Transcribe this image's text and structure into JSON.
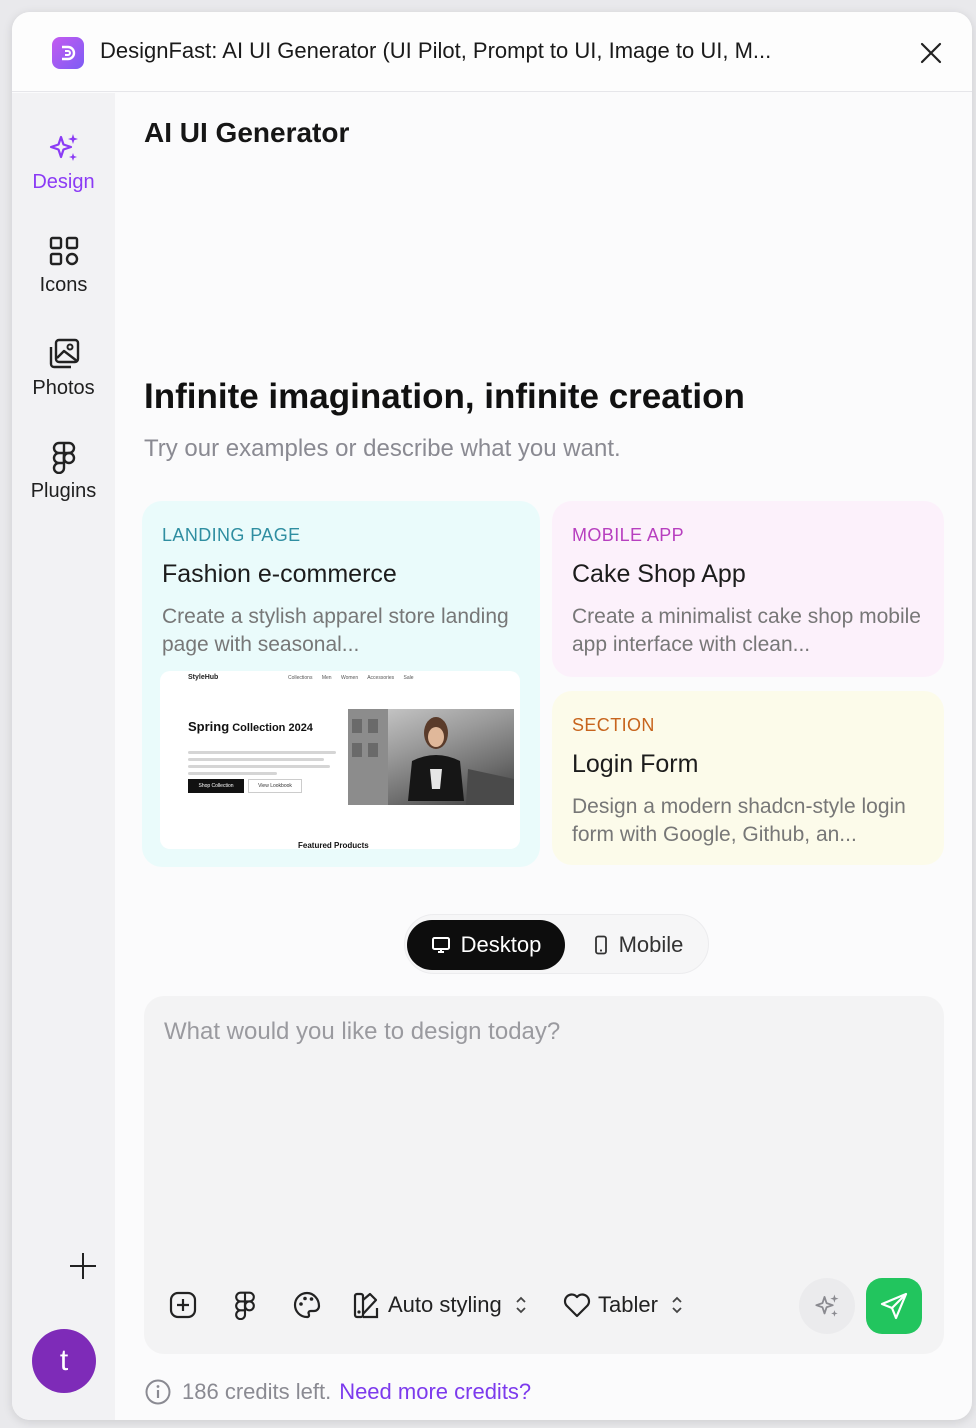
{
  "window": {
    "title": "DesignFast: AI UI Generator (UI Pilot, Prompt to UI, Image to UI, M..."
  },
  "sidebar": {
    "items": [
      {
        "label": "Design",
        "icon": "sparkles-icon"
      },
      {
        "label": "Icons",
        "icon": "grid-icon"
      },
      {
        "label": "Photos",
        "icon": "images-icon"
      },
      {
        "label": "Plugins",
        "icon": "figma-icon"
      }
    ],
    "avatar_letter": "t"
  },
  "main": {
    "page_title": "AI UI Generator",
    "hero_title": "Infinite imagination, infinite creation",
    "hero_subtitle": "Try our examples or describe what you want."
  },
  "cards": [
    {
      "tag": "LANDING PAGE",
      "tag_color": "#2f8ea1",
      "title": "Fashion e-commerce",
      "description": "Create a stylish apparel store landing page with seasonal...",
      "preview": {
        "brand": "StyleHub",
        "links": "Collections Men Women Accessories Sale",
        "heading_bold": "Spring",
        "heading_rest": " Collection 2024",
        "primary_button": "Shop Collection",
        "secondary_button": "View Lookbook",
        "section_heading": "Featured Products"
      }
    },
    {
      "tag": "MOBILE APP",
      "tag_color": "#b73fbf",
      "title": "Cake Shop App",
      "description": "Create a minimalist cake shop mobile app interface with clean..."
    },
    {
      "tag": "SECTION",
      "tag_color": "#c7641d",
      "title": "Login Form",
      "description": "Design a modern shadcn-style login form with Google, Github, an..."
    }
  ],
  "device_toggle": {
    "desktop_label": "Desktop",
    "mobile_label": "Mobile",
    "selected": "Desktop"
  },
  "composer": {
    "placeholder": "What would you like to design today?",
    "styling_label": "Auto styling",
    "library_label": "Tabler"
  },
  "footer": {
    "credits_text": "186 credits left.",
    "credits_link": "Need more credits?"
  }
}
